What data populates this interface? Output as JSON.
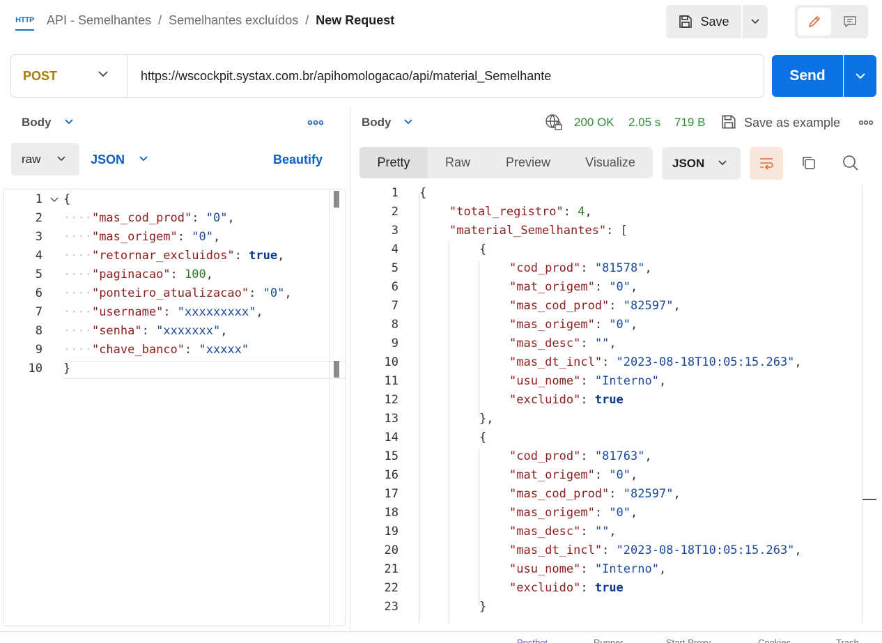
{
  "header": {
    "protocol_badge": "HTTP",
    "breadcrumb": [
      "API - Semelhantes",
      "Semelhantes excluídos"
    ],
    "separator": "/",
    "current": "New Request",
    "save_label": "Save"
  },
  "request": {
    "method": "POST",
    "url": "https://wscockpit.systax.com.br/apihomologacao/api/material_Semelhante",
    "send_label": "Send",
    "method_color": "#a77b00",
    "send_color": "#0b73e6"
  },
  "request_body": {
    "label": "Body",
    "mode": "raw",
    "language": "JSON",
    "beautify_label": "Beautify",
    "lines": [
      {
        "n": "1",
        "indent": 0,
        "key": "",
        "val": "",
        "vtype": "",
        "pre": "{",
        "post": ""
      },
      {
        "n": "2",
        "indent": 1,
        "key": "\"mas_cod_prod\"",
        "val": "\"0\"",
        "vtype": "str",
        "pre": "",
        "post": ","
      },
      {
        "n": "3",
        "indent": 1,
        "key": "\"mas_origem\"",
        "val": "\"0\"",
        "vtype": "str",
        "pre": "",
        "post": ","
      },
      {
        "n": "4",
        "indent": 1,
        "key": "\"retornar_excluidos\"",
        "val": "true",
        "vtype": "bool",
        "pre": "",
        "post": ","
      },
      {
        "n": "5",
        "indent": 1,
        "key": "\"paginacao\"",
        "val": "100",
        "vtype": "num",
        "pre": "",
        "post": ","
      },
      {
        "n": "6",
        "indent": 1,
        "key": "\"ponteiro_atualizacao\"",
        "val": "\"0\"",
        "vtype": "str",
        "pre": "",
        "post": ","
      },
      {
        "n": "7",
        "indent": 1,
        "key": "\"username\"",
        "val": "\"xxxxxxxxx\"",
        "vtype": "str",
        "pre": "",
        "post": ","
      },
      {
        "n": "8",
        "indent": 1,
        "key": "\"senha\"",
        "val": "\"xxxxxxx\"",
        "vtype": "str",
        "pre": "",
        "post": ","
      },
      {
        "n": "9",
        "indent": 1,
        "key": "\"chave_banco\"",
        "val": "\"xxxxx\"",
        "vtype": "str",
        "pre": "",
        "post": ""
      },
      {
        "n": "10",
        "indent": 0,
        "key": "",
        "val": "",
        "vtype": "",
        "pre": "}",
        "post": ""
      }
    ]
  },
  "response": {
    "label": "Body",
    "status": "200 OK",
    "time": "2.05 s",
    "size": "719 B",
    "save_example_label": "Save as example",
    "status_color": "#2e8b3a",
    "tabs": [
      "Pretty",
      "Raw",
      "Preview",
      "Visualize"
    ],
    "active_tab": "Pretty",
    "format": "JSON",
    "lines": [
      {
        "n": "1",
        "indent": 0,
        "key": "",
        "val": "",
        "vtype": "",
        "pre": "{",
        "post": ""
      },
      {
        "n": "2",
        "indent": 1,
        "key": "\"total_registro\"",
        "val": "4",
        "vtype": "num",
        "pre": "",
        "post": ","
      },
      {
        "n": "3",
        "indent": 1,
        "key": "\"material_Semelhantes\"",
        "val": "[",
        "vtype": "punc",
        "pre": "",
        "post": ""
      },
      {
        "n": "4",
        "indent": 2,
        "key": "",
        "val": "",
        "vtype": "",
        "pre": "{",
        "post": ""
      },
      {
        "n": "5",
        "indent": 3,
        "key": "\"cod_prod\"",
        "val": "\"81578\"",
        "vtype": "str",
        "pre": "",
        "post": ","
      },
      {
        "n": "6",
        "indent": 3,
        "key": "\"mat_origem\"",
        "val": "\"0\"",
        "vtype": "str",
        "pre": "",
        "post": ","
      },
      {
        "n": "7",
        "indent": 3,
        "key": "\"mas_cod_prod\"",
        "val": "\"82597\"",
        "vtype": "str",
        "pre": "",
        "post": ","
      },
      {
        "n": "8",
        "indent": 3,
        "key": "\"mas_origem\"",
        "val": "\"0\"",
        "vtype": "str",
        "pre": "",
        "post": ","
      },
      {
        "n": "9",
        "indent": 3,
        "key": "\"mas_desc\"",
        "val": "\"\"",
        "vtype": "str",
        "pre": "",
        "post": ","
      },
      {
        "n": "10",
        "indent": 3,
        "key": "\"mas_dt_incl\"",
        "val": "\"2023-08-18T10:05:15.263\"",
        "vtype": "str",
        "pre": "",
        "post": ","
      },
      {
        "n": "11",
        "indent": 3,
        "key": "\"usu_nome\"",
        "val": "\"Interno\"",
        "vtype": "str",
        "pre": "",
        "post": ","
      },
      {
        "n": "12",
        "indent": 3,
        "key": "\"excluido\"",
        "val": "true",
        "vtype": "bool",
        "pre": "",
        "post": ""
      },
      {
        "n": "13",
        "indent": 2,
        "key": "",
        "val": "",
        "vtype": "",
        "pre": "},",
        "post": ""
      },
      {
        "n": "14",
        "indent": 2,
        "key": "",
        "val": "",
        "vtype": "",
        "pre": "{",
        "post": ""
      },
      {
        "n": "15",
        "indent": 3,
        "key": "\"cod_prod\"",
        "val": "\"81763\"",
        "vtype": "str",
        "pre": "",
        "post": ","
      },
      {
        "n": "16",
        "indent": 3,
        "key": "\"mat_origem\"",
        "val": "\"0\"",
        "vtype": "str",
        "pre": "",
        "post": ","
      },
      {
        "n": "17",
        "indent": 3,
        "key": "\"mas_cod_prod\"",
        "val": "\"82597\"",
        "vtype": "str",
        "pre": "",
        "post": ","
      },
      {
        "n": "18",
        "indent": 3,
        "key": "\"mas_origem\"",
        "val": "\"0\"",
        "vtype": "str",
        "pre": "",
        "post": ","
      },
      {
        "n": "19",
        "indent": 3,
        "key": "\"mas_desc\"",
        "val": "\"\"",
        "vtype": "str",
        "pre": "",
        "post": ","
      },
      {
        "n": "20",
        "indent": 3,
        "key": "\"mas_dt_incl\"",
        "val": "\"2023-08-18T10:05:15.263\"",
        "vtype": "str",
        "pre": "",
        "post": ","
      },
      {
        "n": "21",
        "indent": 3,
        "key": "\"usu_nome\"",
        "val": "\"Interno\"",
        "vtype": "str",
        "pre": "",
        "post": ","
      },
      {
        "n": "22",
        "indent": 3,
        "key": "\"excluido\"",
        "val": "true",
        "vtype": "bool",
        "pre": "",
        "post": ""
      },
      {
        "n": "23",
        "indent": 2,
        "key": "",
        "val": "",
        "vtype": "",
        "pre": "}",
        "post": ""
      }
    ]
  },
  "footer": {
    "items": [
      "Postbot",
      "Runner",
      "Start Proxy",
      "Cookies",
      "Trash"
    ]
  },
  "icons": {
    "protocol": "http-icon",
    "save": "floppy-disk-icon",
    "edit": "pencil-icon",
    "comment": "comment-icon",
    "globe": "globe-lock-icon",
    "wrap": "wrap-lines-icon",
    "copy": "copy-icon",
    "search": "search-icon"
  }
}
